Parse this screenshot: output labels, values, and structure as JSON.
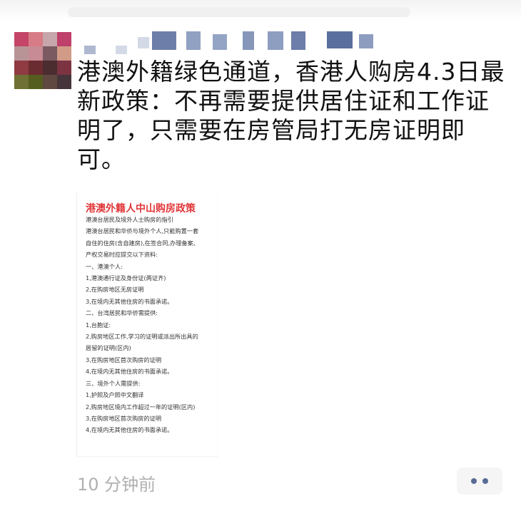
{
  "post": {
    "text": "港澳外籍绿色通道，香港人购房4.3日最新政策：不再需要提供居住证和工作证明了，只需要在房管局打无房证明即可。",
    "time": "10 分钟前"
  },
  "image": {
    "title": "港澳外籍人中山购房政策",
    "lines": [
      "港澳台居民及境外人士购房的指引",
      "港澳台居民和华侨与境外个人,只能购置一套",
      "自住的住房(含自建房),在签合同,办理备案、",
      "产权交易时应提交以下资料:",
      "一、港澳个人:",
      "1,港澳通行证及身份证(两证齐)",
      "2,在购房地区无房证明",
      "3,在境内无其他住房的书面承诺。",
      "二、台湾居民和华侨需提供:",
      "1,台胞证:",
      "2,购房地区工作,学习的证明或派出所出具的",
      "居留的证明(区内)",
      "3,在购房地区首次购房的证明",
      "4,在境内无其他住房的书面承诺。",
      "三、境外个人需提供:",
      "1,护照及户照中文翻译",
      "2,购房地区境内工作超过一年的证明(区内)",
      "3,在购房地区首次购房的证明",
      "4,在境内无其他住房的书面承诺。"
    ]
  },
  "icons": {
    "avatar": "avatar-icon",
    "more": "more-dots-icon"
  },
  "colors": {
    "title_red": "#e1373a",
    "link_blue": "#576b95",
    "time_gray": "#b0b0b0"
  }
}
